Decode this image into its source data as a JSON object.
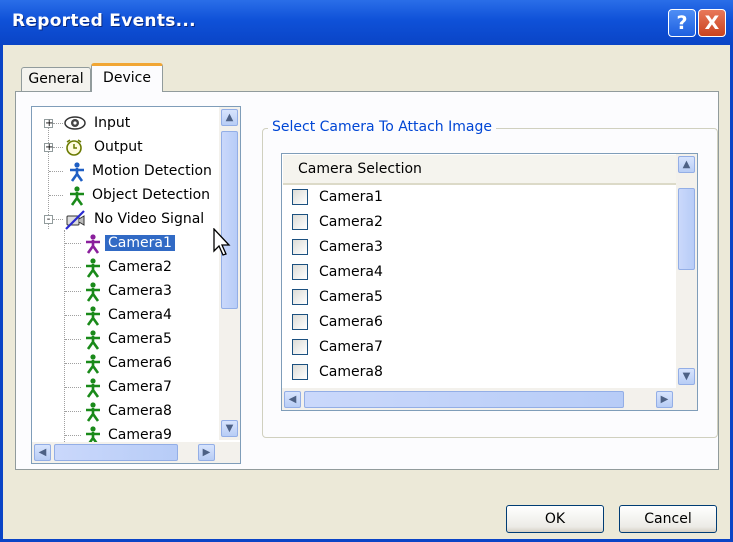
{
  "window": {
    "title": "Reported Events...",
    "help_glyph": "?",
    "close_glyph": "X"
  },
  "tabs": [
    {
      "label": "General",
      "selected": false
    },
    {
      "label": "Device",
      "selected": true
    }
  ],
  "tree": {
    "items": [
      {
        "label": "Input",
        "icon": "eye-icon",
        "expander": "+"
      },
      {
        "label": "Output",
        "icon": "alarm-clock-icon",
        "expander": "+"
      },
      {
        "label": "Motion Detection",
        "icon": "person-blue-icon"
      },
      {
        "label": "Object Detection",
        "icon": "person-green-icon"
      },
      {
        "label": "No Video Signal",
        "icon": "no-video-icon",
        "expander": "-"
      },
      {
        "label": "Camera1",
        "icon": "person-purple-icon",
        "selected": true
      },
      {
        "label": "Camera2",
        "icon": "person-green-icon"
      },
      {
        "label": "Camera3",
        "icon": "person-green-icon"
      },
      {
        "label": "Camera4",
        "icon": "person-green-icon"
      },
      {
        "label": "Camera5",
        "icon": "person-green-icon"
      },
      {
        "label": "Camera6",
        "icon": "person-green-icon"
      },
      {
        "label": "Camera7",
        "icon": "person-green-icon"
      },
      {
        "label": "Camera8",
        "icon": "person-green-icon"
      },
      {
        "label": "Camera9",
        "icon": "person-green-icon"
      }
    ]
  },
  "camera_group": {
    "label": "Select Camera To Attach Image",
    "column_header": "Camera Selection",
    "cameras": [
      {
        "label": "Camera1",
        "checked": false
      },
      {
        "label": "Camera2",
        "checked": false
      },
      {
        "label": "Camera3",
        "checked": false
      },
      {
        "label": "Camera4",
        "checked": false
      },
      {
        "label": "Camera5",
        "checked": false
      },
      {
        "label": "Camera6",
        "checked": false
      },
      {
        "label": "Camera7",
        "checked": false
      },
      {
        "label": "Camera8",
        "checked": false
      }
    ]
  },
  "buttons": {
    "ok": "OK",
    "cancel": "Cancel"
  },
  "colors": {
    "title_bar": "#0a44c6",
    "selection": "#316ac5",
    "group_label": "#0046d5",
    "icon_green": "#1a8a1a",
    "icon_blue": "#1f5fc4",
    "icon_purple": "#8a1f9c"
  }
}
